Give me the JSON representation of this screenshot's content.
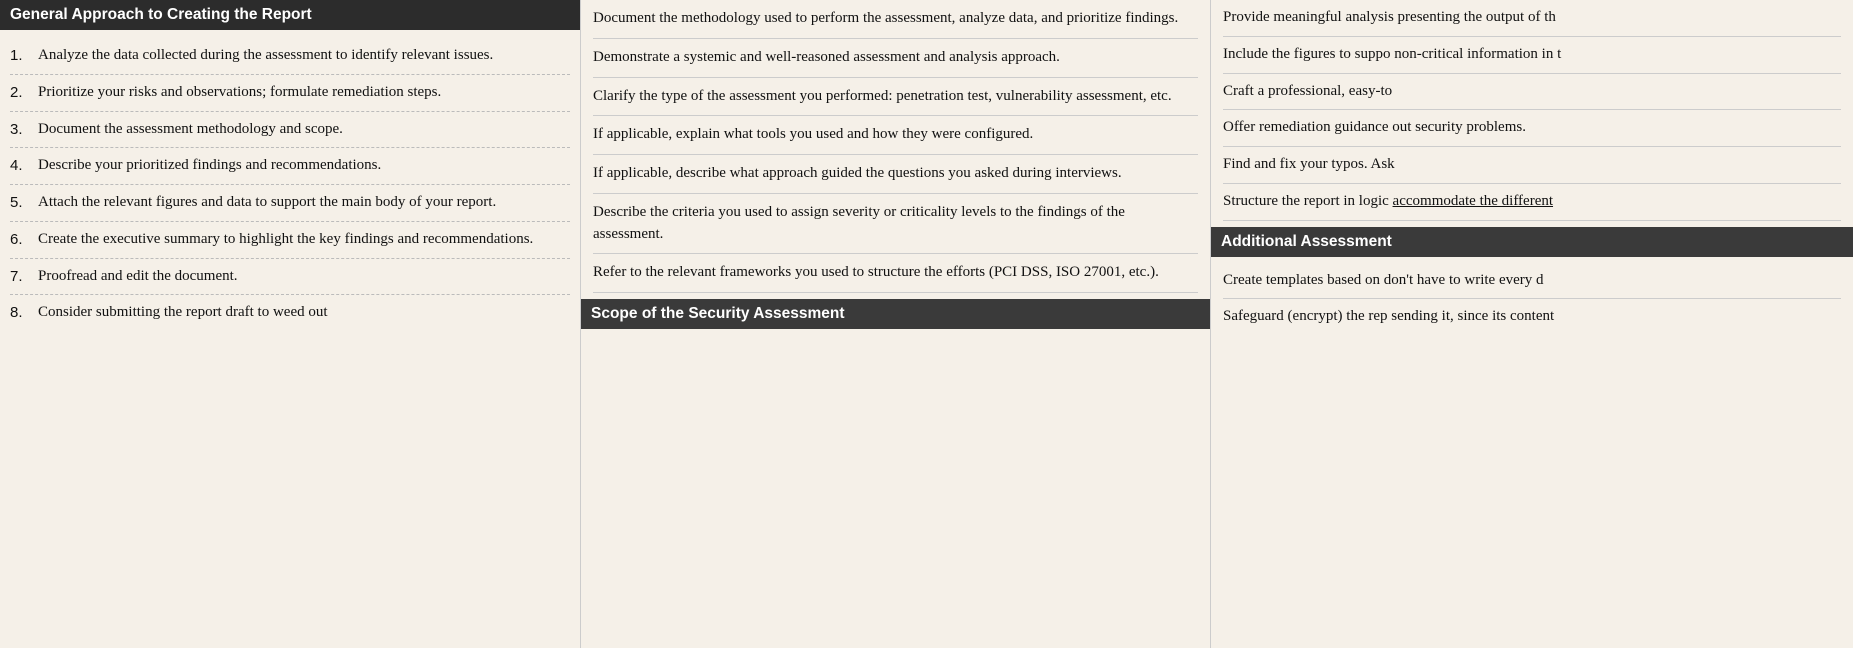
{
  "col1": {
    "header": "General Approach to Creating the Report",
    "items": [
      {
        "number": "1.",
        "text": "Analyze the data collected during the assessment to identify relevant issues."
      },
      {
        "number": "2.",
        "text": "Prioritize your risks and observations; formulate remediation steps."
      },
      {
        "number": "3.",
        "text": "Document the assessment methodology and scope."
      },
      {
        "number": "4.",
        "text": "Describe your prioritized findings and recommendations."
      },
      {
        "number": "5.",
        "text": "Attach the relevant figures and data to support the main body of your report."
      },
      {
        "number": "6.",
        "text": "Create the executive summary to highlight the key findings and recommendations."
      },
      {
        "number": "7.",
        "text": "Proofread and edit the document."
      },
      {
        "number": "8.",
        "text": "Consider submitting the report draft to weed out"
      }
    ]
  },
  "col2": {
    "items": [
      {
        "text": "Document the methodology used to perform the assessment, analyze data, and prioritize findings."
      },
      {
        "text": "Demonstrate a systemic and well-reasoned assessment and analysis approach."
      },
      {
        "text": "Clarify the type of the assessment you performed: penetration test, vulnerability assessment, etc."
      },
      {
        "text": "If applicable, explain what tools you used and how they were configured."
      },
      {
        "text": "If applicable, describe what approach guided the questions you asked during interviews."
      },
      {
        "text": "Describe the criteria you used to assign severity or criticality levels to the findings of the assessment."
      },
      {
        "text": "Refer to the relevant frameworks you used to structure the efforts (PCI DSS, ISO 27001, etc.)."
      }
    ],
    "scope_header": "Scope of the Security Assessment"
  },
  "col3": {
    "items": [
      {
        "text": "Provide meaningful analysis presenting the output of th",
        "truncated": true
      },
      {
        "text": "Include the figures to suppo non-critical information in t",
        "truncated": true
      },
      {
        "text": "Craft a professional, easy-to",
        "truncated": true
      },
      {
        "text": "Offer remediation guidance out security problems.",
        "truncated": false
      },
      {
        "text": "Find and fix your typos. Ask",
        "truncated": true
      },
      {
        "text": "Structure the report in logic accommodate the different",
        "truncated": true,
        "underline": "accommodate the different"
      },
      {
        "is_header": true,
        "header_text": "Additional Assessment"
      },
      {
        "text": "Create templates based on don't have to write every d",
        "truncated": true
      },
      {
        "text": "Safeguard (encrypt) the rep sending it, since its content",
        "truncated": true
      }
    ]
  }
}
